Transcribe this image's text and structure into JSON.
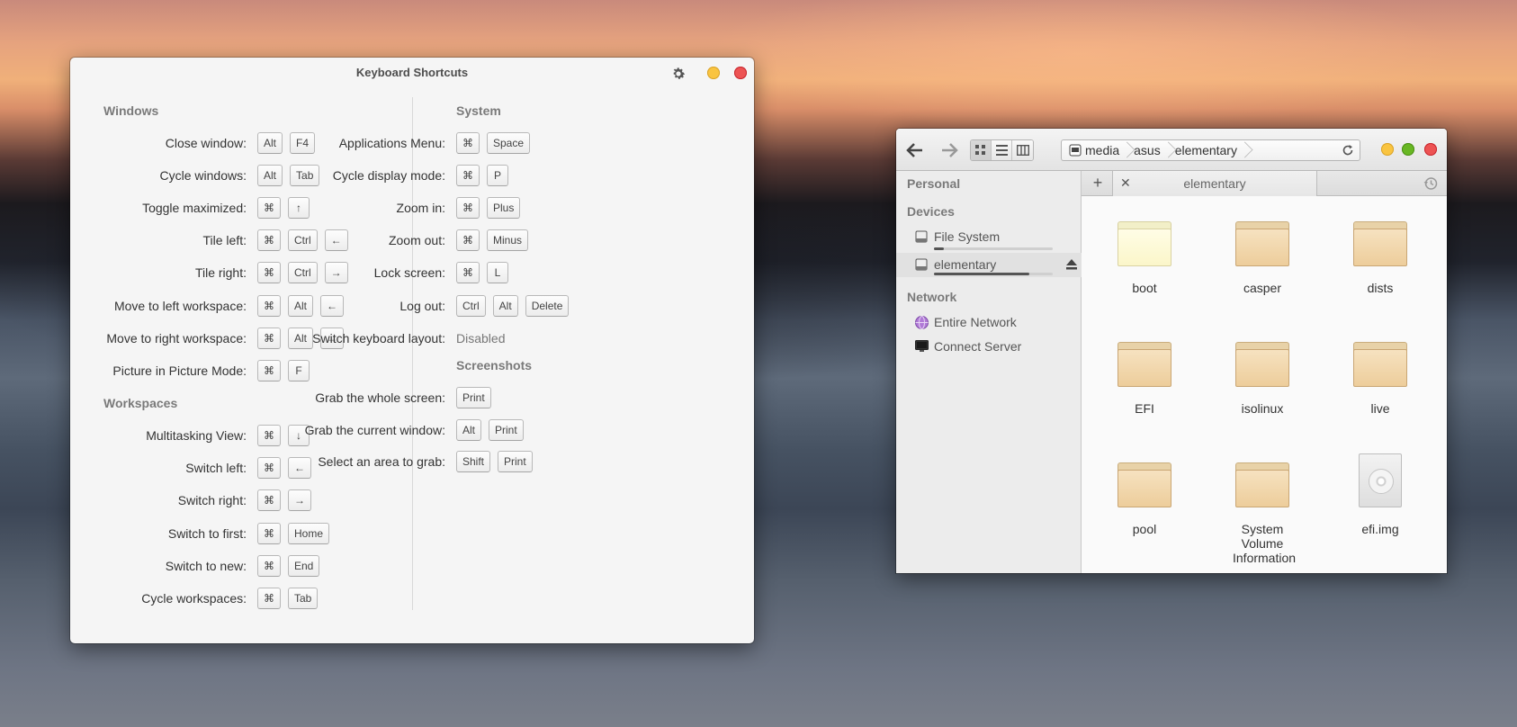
{
  "shortcuts_window": {
    "title": "Keyboard Shortcuts",
    "sections": {
      "windows": {
        "title": "Windows",
        "rows": [
          {
            "label": "Close window:",
            "keys": [
              "Alt",
              "F4"
            ]
          },
          {
            "label": "Cycle windows:",
            "keys": [
              "Alt",
              "Tab"
            ]
          },
          {
            "label": "Toggle maximized:",
            "keys": [
              "⌘",
              "↑"
            ]
          },
          {
            "label": "Tile left:",
            "keys": [
              "⌘",
              "Ctrl",
              "←"
            ]
          },
          {
            "label": "Tile right:",
            "keys": [
              "⌘",
              "Ctrl",
              "→"
            ]
          },
          {
            "label": "Move to left workspace:",
            "keys": [
              "⌘",
              "Alt",
              "←"
            ]
          },
          {
            "label": "Move to right workspace:",
            "keys": [
              "⌘",
              "Alt",
              "→"
            ]
          },
          {
            "label": "Picture in Picture Mode:",
            "keys": [
              "⌘",
              "F"
            ]
          }
        ]
      },
      "workspaces": {
        "title": "Workspaces",
        "rows": [
          {
            "label": "Multitasking View:",
            "keys": [
              "⌘",
              "↓"
            ]
          },
          {
            "label": "Switch left:",
            "keys": [
              "⌘",
              "←"
            ]
          },
          {
            "label": "Switch right:",
            "keys": [
              "⌘",
              "→"
            ]
          },
          {
            "label": "Switch to first:",
            "keys": [
              "⌘",
              "Home"
            ]
          },
          {
            "label": "Switch to new:",
            "keys": [
              "⌘",
              "End"
            ]
          },
          {
            "label": "Cycle workspaces:",
            "keys": [
              "⌘",
              "Tab"
            ]
          }
        ]
      },
      "system": {
        "title": "System",
        "rows": [
          {
            "label": "Applications Menu:",
            "keys": [
              "⌘",
              "Space"
            ]
          },
          {
            "label": "Cycle display mode:",
            "keys": [
              "⌘",
              "P"
            ]
          },
          {
            "label": "Zoom in:",
            "keys": [
              "⌘",
              "Plus"
            ]
          },
          {
            "label": "Zoom out:",
            "keys": [
              "⌘",
              "Minus"
            ]
          },
          {
            "label": "Lock screen:",
            "keys": [
              "⌘",
              "L"
            ]
          },
          {
            "label": "Log out:",
            "keys": [
              "Ctrl",
              "Alt",
              "Delete"
            ]
          },
          {
            "label": "Switch keyboard layout:",
            "value": "Disabled"
          }
        ]
      },
      "screenshots": {
        "title": "Screenshots",
        "rows": [
          {
            "label": "Grab the whole screen:",
            "keys": [
              "Print"
            ]
          },
          {
            "label": "Grab the current window:",
            "keys": [
              "Alt",
              "Print"
            ]
          },
          {
            "label": "Select an area to grab:",
            "keys": [
              "Shift",
              "Print"
            ]
          }
        ]
      }
    }
  },
  "files_window": {
    "path": [
      "media",
      "asus",
      "elementary"
    ],
    "tab_label": "elementary",
    "sidebar": {
      "personal": "Personal",
      "devices": "Devices",
      "file_system": "File System",
      "file_system_usage": 0.08,
      "elementary": "elementary",
      "elementary_usage": 0.8,
      "network": "Network",
      "entire_network": "Entire Network",
      "connect_server": "Connect Server"
    },
    "items": [
      {
        "name": "boot",
        "type": "folder-open"
      },
      {
        "name": "casper",
        "type": "folder"
      },
      {
        "name": "dists",
        "type": "folder"
      },
      {
        "name": "EFI",
        "type": "folder"
      },
      {
        "name": "isolinux",
        "type": "folder"
      },
      {
        "name": "live",
        "type": "folder"
      },
      {
        "name": "pool",
        "type": "folder"
      },
      {
        "name": "System Volume Information",
        "type": "folder"
      },
      {
        "name": "efi.img",
        "type": "disc-image"
      }
    ]
  },
  "colors": {
    "close": "#ed5353",
    "minimize": "#f9c440",
    "maximize": "#68b723"
  }
}
